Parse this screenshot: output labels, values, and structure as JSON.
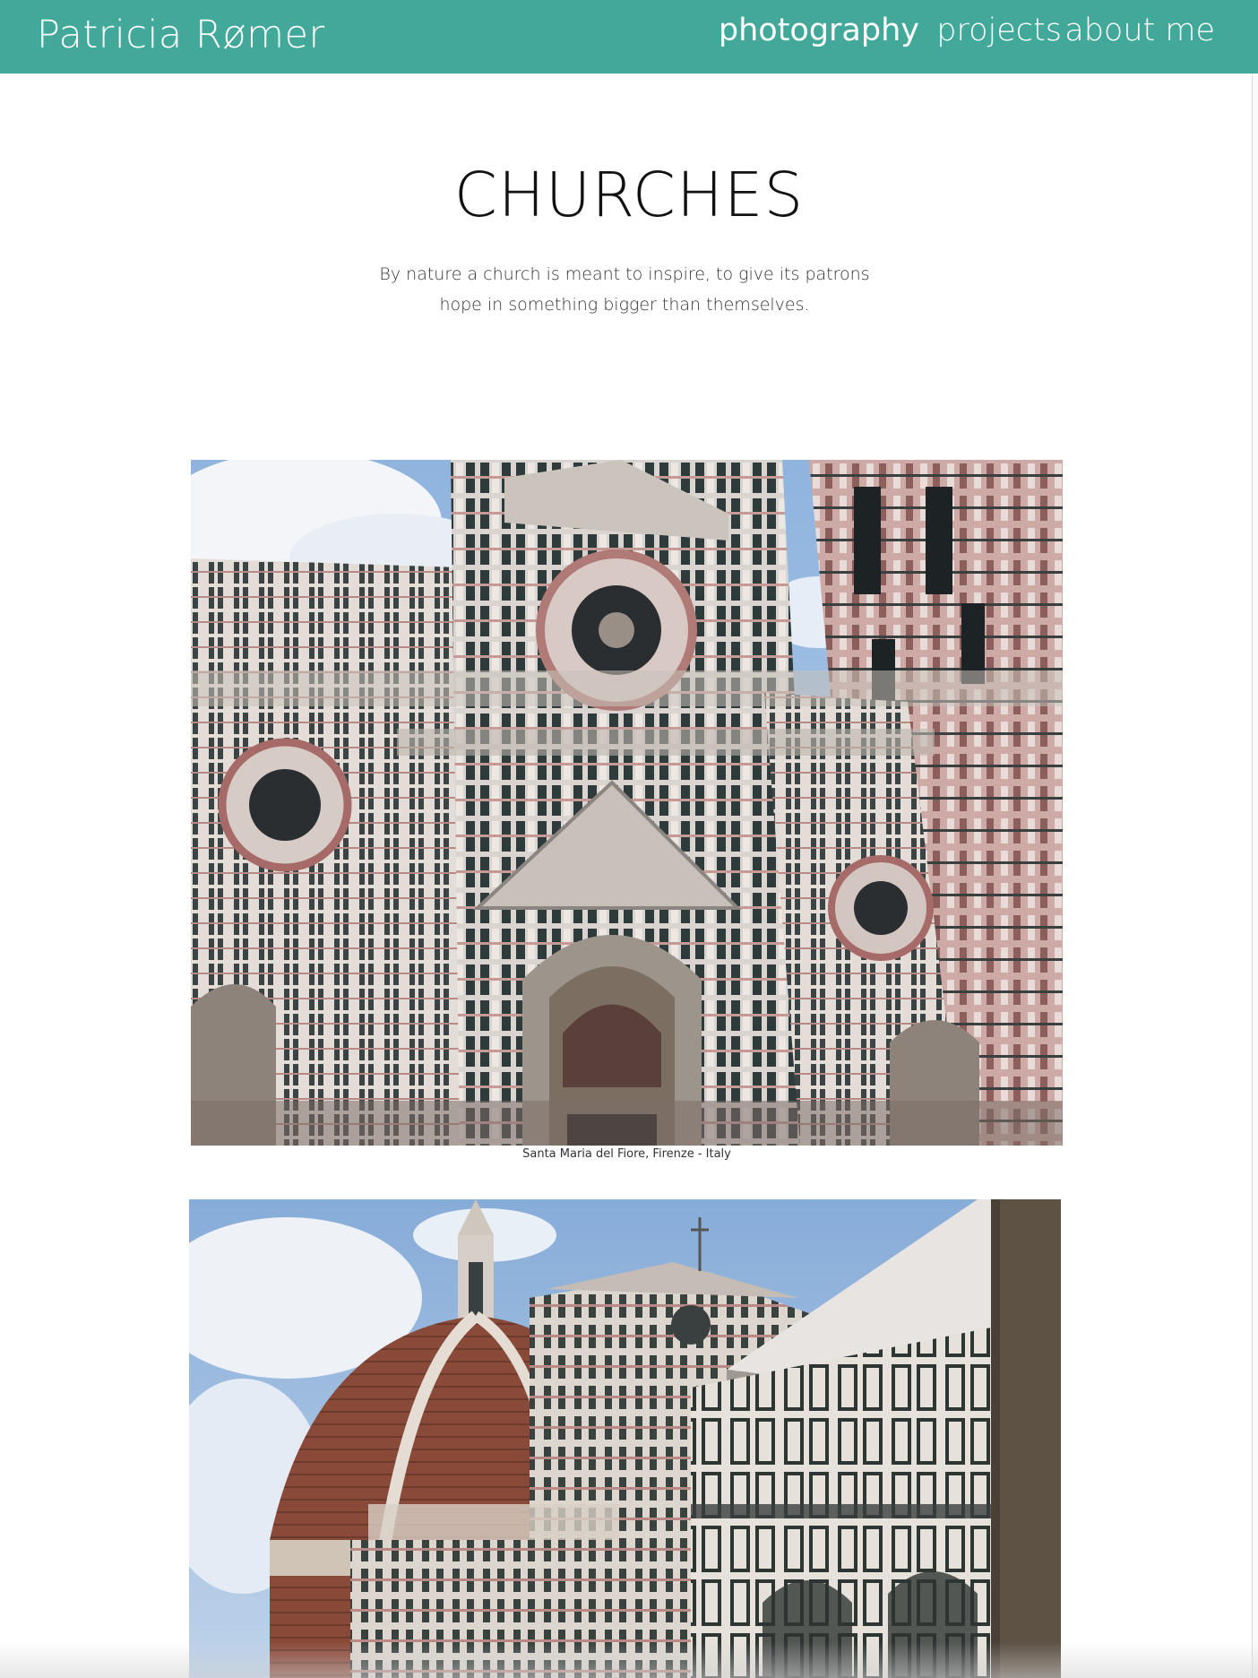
{
  "header": {
    "site_name": "Patricia Rømer",
    "nav": [
      {
        "label": "photography",
        "active": true
      },
      {
        "label": "projects",
        "active": false
      },
      {
        "label": "about me",
        "active": false
      }
    ],
    "color": "#42a899"
  },
  "main": {
    "title": "CHURCHES",
    "intro": "By nature a church is meant to inspire, to give its patrons hope in something bigger than themselves.",
    "photos": [
      {
        "caption": "Santa Maria del Fiore, Firenze - Italy"
      },
      {
        "caption": ""
      }
    ]
  }
}
